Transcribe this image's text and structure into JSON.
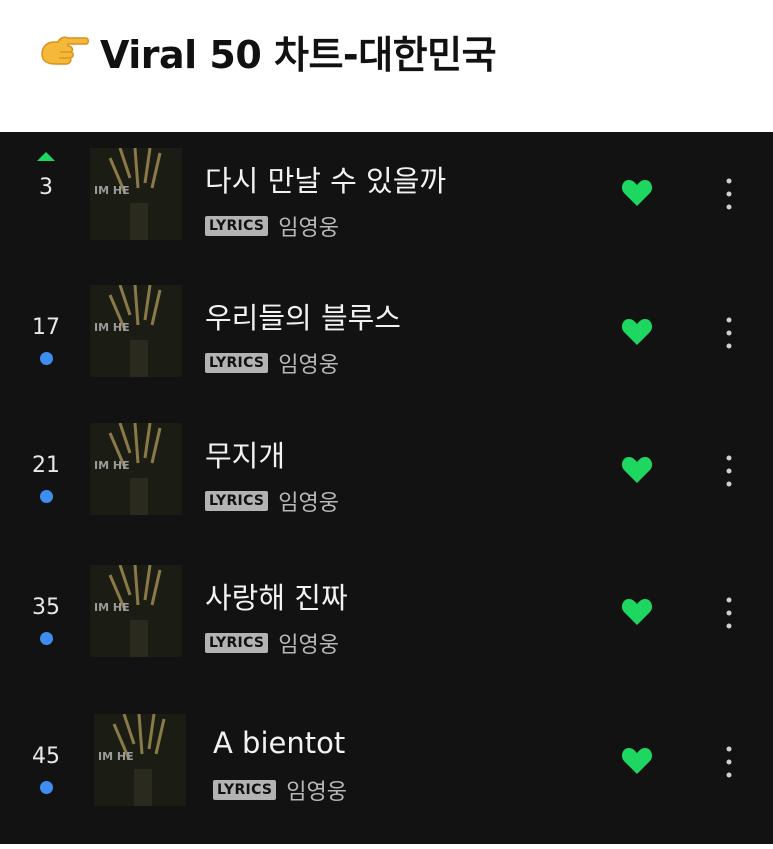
{
  "header": {
    "title": "Viral 50 차트-대한민국",
    "icon": "backhand-pointing-right-emoji"
  },
  "colors": {
    "panel_bg": "#121212",
    "liked_heart": "#1ed760",
    "new_entry_dot": "#3d8ef0",
    "rank_up": "#1ed760"
  },
  "tracks": [
    {
      "rank": "3",
      "status": "up",
      "title": "다시 만날 수 있을까",
      "badge": "LYRICS",
      "artist": "임영웅",
      "cover_text": "IM HE",
      "liked": true
    },
    {
      "rank": "17",
      "status": "new",
      "title": "우리들의 블루스",
      "badge": "LYRICS",
      "artist": "임영웅",
      "cover_text": "IM HE",
      "liked": true
    },
    {
      "rank": "21",
      "status": "new",
      "title": "무지개",
      "badge": "LYRICS",
      "artist": "임영웅",
      "cover_text": "IM HE",
      "liked": true
    },
    {
      "rank": "35",
      "status": "new",
      "title": "사랑해 진짜",
      "badge": "LYRICS",
      "artist": "임영웅",
      "cover_text": "IM HE",
      "liked": true
    },
    {
      "rank": "45",
      "status": "new",
      "title": "A bientot",
      "badge": "LYRICS",
      "artist": "임영웅",
      "cover_text": "IM HE",
      "liked": true
    }
  ]
}
